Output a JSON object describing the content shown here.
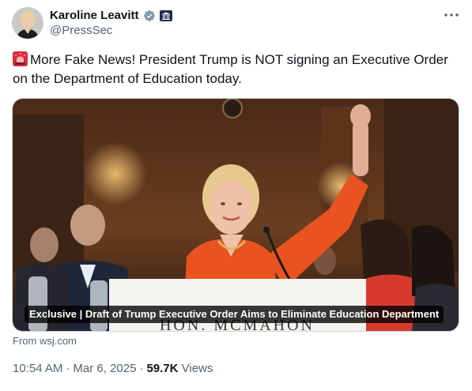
{
  "author": {
    "display_name": "Karoline Leavitt",
    "handle": "@PressSec",
    "verified_color": "#829aab",
    "avatar_icon": "profile-photo"
  },
  "post": {
    "emoji": "siren-emoji",
    "text": "More Fake News! President Trump is NOT signing an Executive Order on the Department of Education today."
  },
  "media": {
    "headline": "Exclusive | Draft of Trump Executive Order Aims to Eliminate Education Department",
    "podium_text": "HON. MCMAHON",
    "source": "From wsj.com"
  },
  "meta": {
    "time": "10:54 AM",
    "date": "Mar 6, 2025",
    "views_count": "59.7K",
    "views_label": "Views"
  },
  "colors": {
    "text_primary": "#0f1419",
    "text_secondary": "#536471",
    "jacket": "#e8531f"
  }
}
